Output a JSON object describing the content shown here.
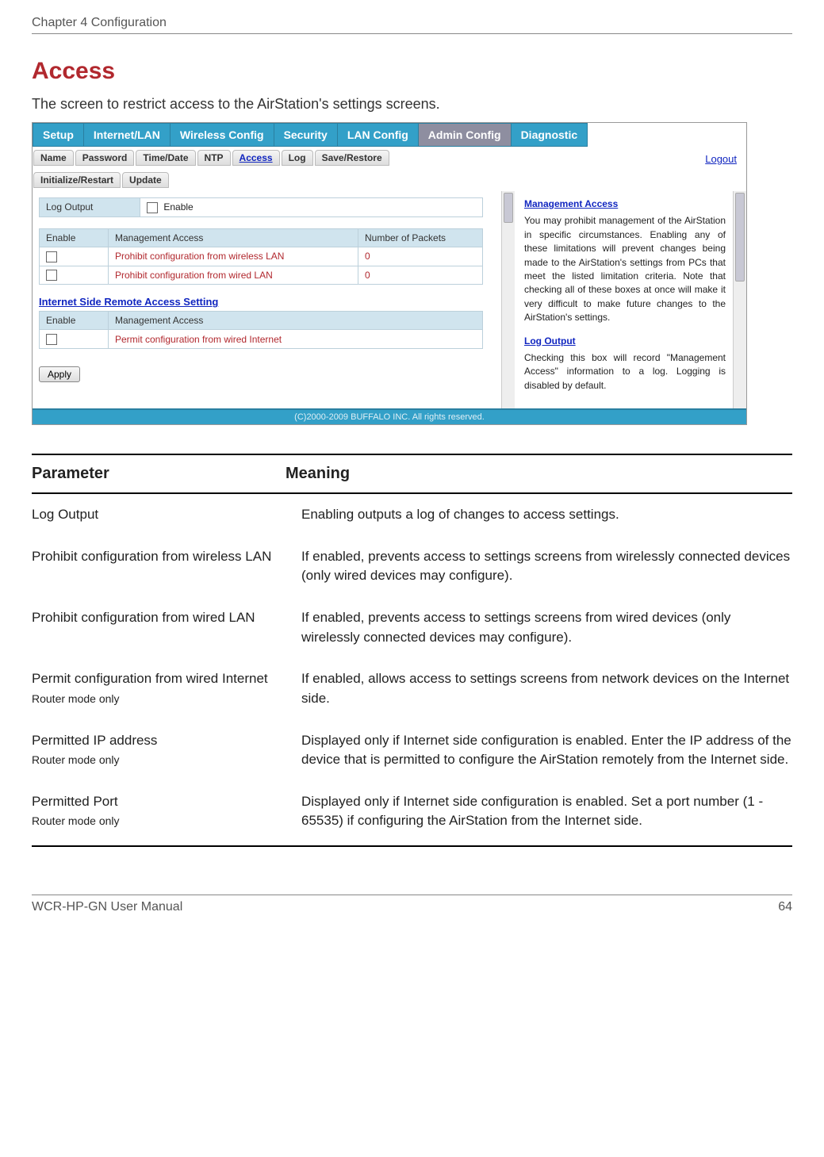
{
  "chapter_header": "Chapter 4  Configuration",
  "section_title": "Access",
  "intro_text": "The screen to restrict access to the AirStation's settings screens.",
  "screenshot": {
    "main_tabs": [
      "Setup",
      "Internet/LAN",
      "Wireless Config",
      "Security",
      "LAN Config",
      "Admin Config",
      "Diagnostic"
    ],
    "main_tabs_active_index": 5,
    "sub_tabs_row1": [
      "Name",
      "Password",
      "Time/Date",
      "NTP",
      "Access",
      "Log",
      "Save/Restore"
    ],
    "sub_tabs_row2": [
      "Initialize/Restart",
      "Update"
    ],
    "sub_tab_selected": "Access",
    "logout": "Logout",
    "left": {
      "log_output_label": "Log Output",
      "log_output_checkbox_label": "Enable",
      "mgmt_table": {
        "headers": [
          "Enable",
          "Management Access",
          "Number of Packets"
        ],
        "rows": [
          {
            "label": "Prohibit configuration from wireless LAN",
            "packets": "0"
          },
          {
            "label": "Prohibit configuration from wired LAN",
            "packets": "0"
          }
        ]
      },
      "remote_section_title": "Internet Side Remote Access Setting",
      "remote_table": {
        "headers": [
          "Enable",
          "Management Access"
        ],
        "rows": [
          {
            "label": "Permit configuration from wired Internet"
          }
        ]
      },
      "apply_label": "Apply"
    },
    "right": {
      "help1_title": "Management Access",
      "help1_body": "You may prohibit management of the AirStation in specific circumstances. Enabling any of these limitations will prevent changes being made to the AirStation's settings from PCs that meet the listed limitation criteria. Note that checking all of these boxes at once will make it very difficult to make future changes to the AirStation's settings.",
      "help2_title": "Log Output",
      "help2_body": "Checking this box will record \"Management Access\" information to a log. Logging is disabled by default."
    },
    "footer": "(C)2000-2009 BUFFALO INC. All rights reserved."
  },
  "param_table": {
    "headers": {
      "param": "Parameter",
      "meaning": "Meaning"
    },
    "rows": [
      {
        "param": "Log Output",
        "note": "",
        "meaning": "Enabling outputs a log of changes to access settings."
      },
      {
        "param": "Prohibit configuration from wireless LAN",
        "note": "",
        "meaning": "If enabled, prevents access to settings screens from wirelessly connected devices (only wired devices may configure)."
      },
      {
        "param": "Prohibit configuration from wired LAN",
        "note": "",
        "meaning": "If enabled, prevents access to settings screens from wired devices (only wirelessly connected devices may configure)."
      },
      {
        "param": "Permit configuration from wired Internet",
        "note": "Router mode only",
        "meaning": "If enabled, allows access to settings screens from network devices on the Internet side."
      },
      {
        "param": "Permitted IP address",
        "note": "Router mode only",
        "meaning": "Displayed only if Internet side configuration is enabled. Enter the IP address of the device that is permitted to configure the AirStation remotely from the Internet side."
      },
      {
        "param": "Permitted Port",
        "note": "Router mode only",
        "meaning": "Displayed only if Internet side configuration is enabled. Set a port number (1 - 65535) if configuring the AirStation from the Internet side."
      }
    ]
  },
  "page_footer_left": "WCR-HP-GN User Manual",
  "page_footer_right": "64"
}
